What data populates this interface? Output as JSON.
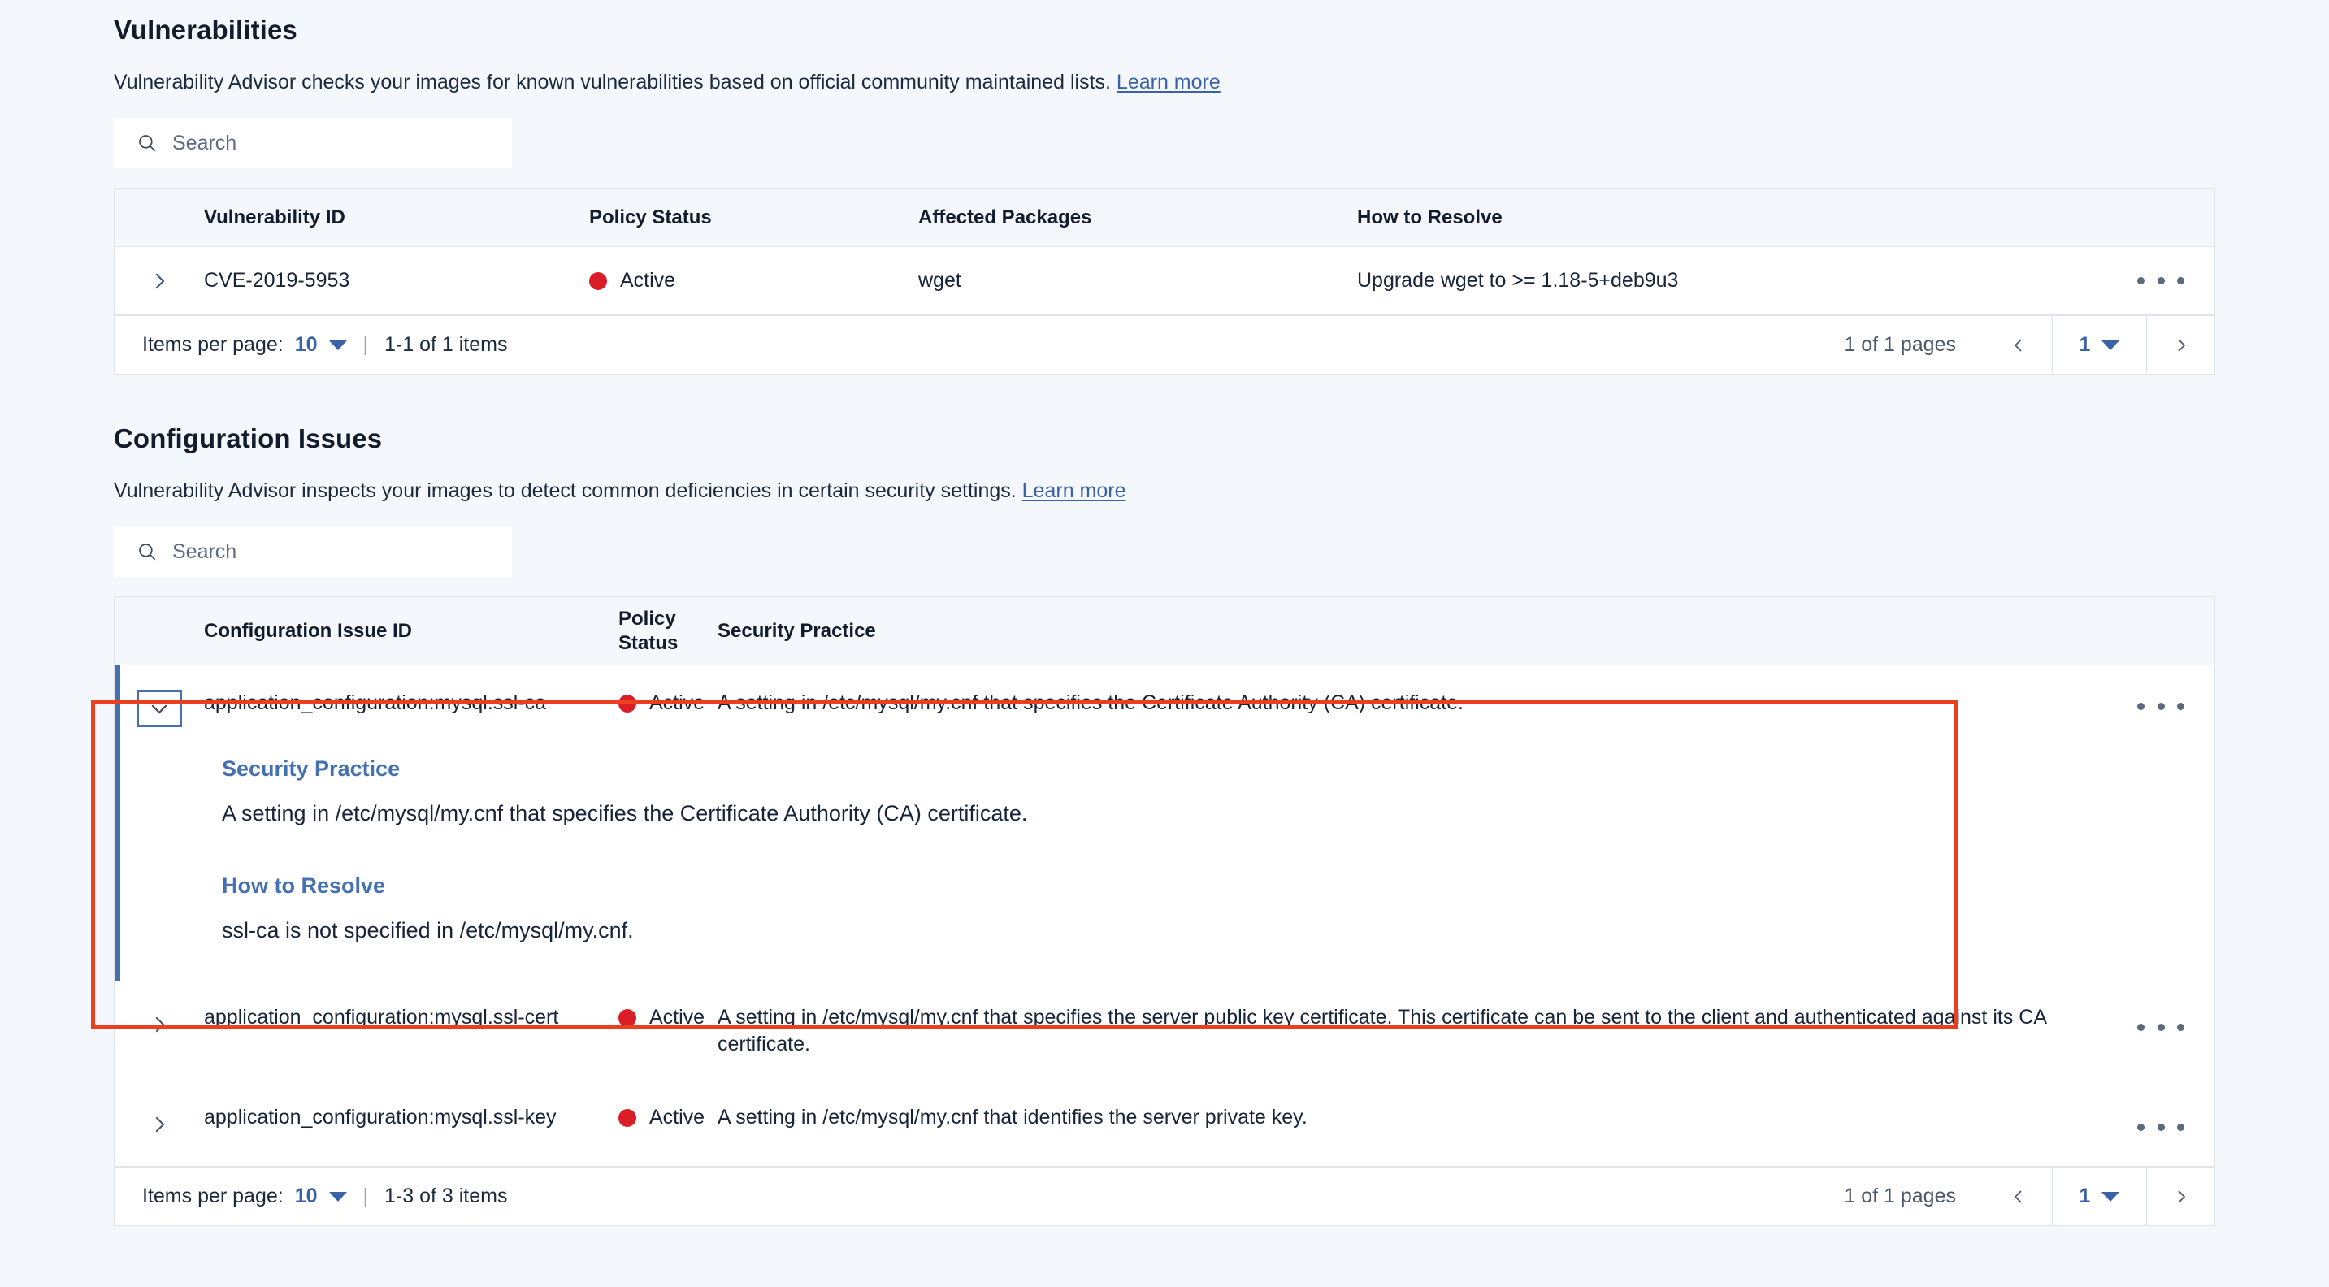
{
  "vulnerabilities": {
    "title": "Vulnerabilities",
    "description": "Vulnerability Advisor checks your images for known vulnerabilities based on official community maintained lists.",
    "learn_more": "Learn more",
    "search_placeholder": "Search",
    "search_value": "",
    "search_icon": "search-icon",
    "columns": [
      "Vulnerability ID",
      "Policy Status",
      "Affected Packages",
      "How to Resolve"
    ],
    "rows": [
      {
        "id": "CVE-2019-5953",
        "status": "Active",
        "status_color": "#da1e28",
        "packages": "wget",
        "resolve": "Upgrade wget to >= 1.18-5+deb9u3",
        "expand_icon": "chevron-right-icon",
        "overflow_icon": "overflow-menu-icon"
      }
    ],
    "pager": {
      "items_per_page_label": "Items per page:",
      "items_per_page_value": "10",
      "separator": "|",
      "range_text": "1-1 of 1 items",
      "pages_text": "1 of 1 pages",
      "prev_icon": "chevron-left-icon",
      "next_icon": "chevron-right-icon",
      "page_value": "1"
    }
  },
  "configuration_issues": {
    "title": "Configuration Issues",
    "description": "Vulnerability Advisor inspects your images to detect common deficiencies in certain security settings.",
    "learn_more": "Learn more",
    "search_placeholder": "Search",
    "search_value": "",
    "search_icon": "search-icon",
    "columns": [
      "Configuration Issue ID",
      "Policy\nStatus",
      "Security Practice"
    ],
    "columns_flat": {
      "issue_id": "Configuration Issue ID",
      "policy_line1": "Policy",
      "policy_line2": "Status",
      "security_practice": "Security Practice"
    },
    "rows": [
      {
        "id": "application_configuration:mysql.ssl-ca",
        "status": "Active",
        "status_color": "#da1e28",
        "practice": "A setting in /etc/mysql/my.cnf that specifies the Certificate Authority (CA) certificate.",
        "expanded": true,
        "expand_icon": "chevron-down-icon",
        "overflow_icon": "overflow-menu-icon",
        "detail": {
          "security_practice_heading": "Security Practice",
          "security_practice_text": "A setting in /etc/mysql/my.cnf that specifies the Certificate Authority (CA) certificate.",
          "how_to_resolve_heading": "How to Resolve",
          "how_to_resolve_text": "ssl-ca is not specified in /etc/mysql/my.cnf."
        }
      },
      {
        "id": "application_configuration:mysql.ssl-cert",
        "status": "Active",
        "status_color": "#da1e28",
        "practice": "A setting in /etc/mysql/my.cnf that specifies the server public key certificate. This certificate can be sent to the client and authenticated against its CA certificate.",
        "expanded": false,
        "expand_icon": "chevron-right-icon",
        "overflow_icon": "overflow-menu-icon"
      },
      {
        "id": "application_configuration:mysql.ssl-key",
        "status": "Active",
        "status_color": "#da1e28",
        "practice": "A setting in /etc/mysql/my.cnf that identifies the server private key.",
        "expanded": false,
        "expand_icon": "chevron-right-icon",
        "overflow_icon": "overflow-menu-icon"
      }
    ],
    "pager": {
      "items_per_page_label": "Items per page:",
      "items_per_page_value": "10",
      "separator": "|",
      "range_text": "1-3 of 3 items",
      "pages_text": "1 of 1 pages",
      "prev_icon": "chevron-left-icon",
      "next_icon": "chevron-right-icon",
      "page_value": "1"
    }
  },
  "annotation": {
    "color": "#eb3f20",
    "target": "expanded-configuration-issue-row"
  },
  "theme": {
    "accent_blue": "#4671b0",
    "link_blue": "#3a62a8",
    "status_red": "#da1e28",
    "page_bg": "#f4f7fb",
    "surface": "#ffffff",
    "border": "#dfe4ea"
  }
}
